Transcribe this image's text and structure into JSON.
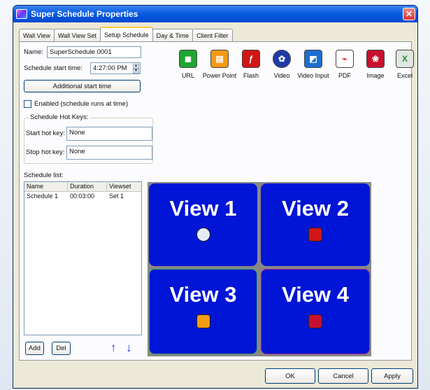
{
  "window": {
    "title": "Super Schedule Properties"
  },
  "tabs": [
    {
      "label": "Wall View"
    },
    {
      "label": "Wall View Set"
    },
    {
      "label": "Setup Schedule"
    },
    {
      "label": "Day & Time"
    },
    {
      "label": "Client Filter"
    }
  ],
  "form": {
    "name_label": "Name:",
    "name_value": "SuperSchedule 0001",
    "start_time_label": "Schedule start time:",
    "start_time_value": "4:27:00 PM",
    "additional_start_button": "Additional start time",
    "enabled_label": "Enabled (schedule runs at time)",
    "hotkeys_group": "Schedule Hot Keys:",
    "start_hotkey_label": "Start hot key:",
    "start_hotkey_value": "None",
    "stop_hotkey_label": "Stop hot key:",
    "stop_hotkey_value": "None"
  },
  "tools": [
    {
      "label": "URL",
      "icon": "url-icon",
      "color": "#1fa531"
    },
    {
      "label": "Power Point",
      "icon": "powerpoint-icon",
      "color": "#f49a13"
    },
    {
      "label": "Flash",
      "icon": "flash-icon",
      "color": "#d01616"
    },
    {
      "label": "Video",
      "icon": "video-reel-icon",
      "color": "#1f3aa8"
    },
    {
      "label": "Video Input",
      "icon": "video-input-icon",
      "color": "#1c6fd1"
    },
    {
      "label": "PDF",
      "icon": "pdf-icon",
      "color": "#e23232"
    },
    {
      "label": "Image",
      "icon": "image-icon",
      "color": "#c8102e"
    },
    {
      "label": "Excel",
      "icon": "excel-icon",
      "color": "#2e8b3b"
    }
  ],
  "schedule_list": {
    "label": "Schedule list:",
    "columns": [
      "Name",
      "Duration",
      "Viewset"
    ],
    "rows": [
      [
        "Schedule 1",
        "00:03:00",
        "Set 1"
      ]
    ]
  },
  "list_buttons": {
    "add": "Add",
    "del": "Del",
    "up": "↑",
    "down": "↓"
  },
  "views": [
    {
      "label": "View 1",
      "icon": "video-reel-icon"
    },
    {
      "label": "View 2",
      "icon": "flash-icon"
    },
    {
      "label": "View 3",
      "icon": "powerpoint-icon"
    },
    {
      "label": "View 4",
      "icon": "image-icon"
    }
  ],
  "dialog_buttons": {
    "ok": "OK",
    "cancel": "Cancel",
    "apply": "Apply"
  },
  "colors": {
    "view_bg": "#0015d6",
    "titlebar": "#0a5ce0",
    "accent_tab": "#ffc83c"
  }
}
